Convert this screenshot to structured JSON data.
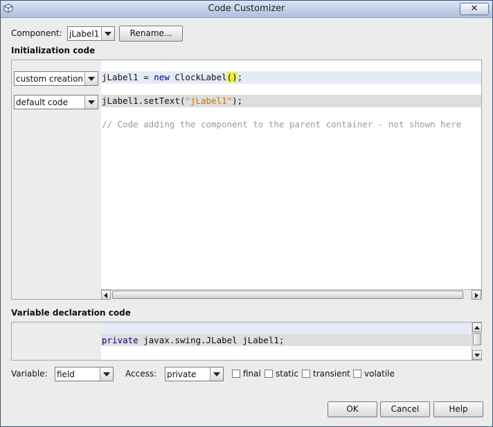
{
  "window": {
    "title": "Code Customizer",
    "close_glyph": "✕"
  },
  "component": {
    "label": "Component:",
    "value": "jLabel1",
    "rename_label": "Rename..."
  },
  "init_section": {
    "heading": "Initialization code",
    "row1_combo": "custom creation",
    "row2_combo": "default code",
    "line1": {
      "target": "jLabel1",
      "op": " = ",
      "kw": "new",
      "cls": " ClockLabel",
      "paren": "()",
      "end": ";"
    },
    "line2": {
      "pre": "jLabel1.setText(",
      "str": "\"jLabel1\"",
      "end": ");"
    },
    "line3": "// Code adding the component to the parent container - not shown here"
  },
  "var_section": {
    "heading": "Variable declaration code",
    "code_kw": "private",
    "code_rest": " javax.swing.JLabel jLabel1;"
  },
  "options": {
    "variable_label": "Variable:",
    "variable_value": "field",
    "access_label": "Access:",
    "access_value": "private",
    "final_label": "final",
    "static_label": "static",
    "transient_label": "transient",
    "volatile_label": "volatile"
  },
  "buttons": {
    "ok": "OK",
    "cancel": "Cancel",
    "help": "Help"
  },
  "colors": {
    "keyword": "#00008b",
    "string": "#c97400",
    "bracket_highlight": "#f0f040",
    "comment": "#999999",
    "titlebar": "#c5d3ea"
  },
  "icons": [
    "window-icon",
    "close-icon",
    "dropdown-arrow-icon",
    "scroll-left-icon",
    "scroll-right-icon",
    "scroll-up-icon",
    "scroll-down-icon"
  ]
}
